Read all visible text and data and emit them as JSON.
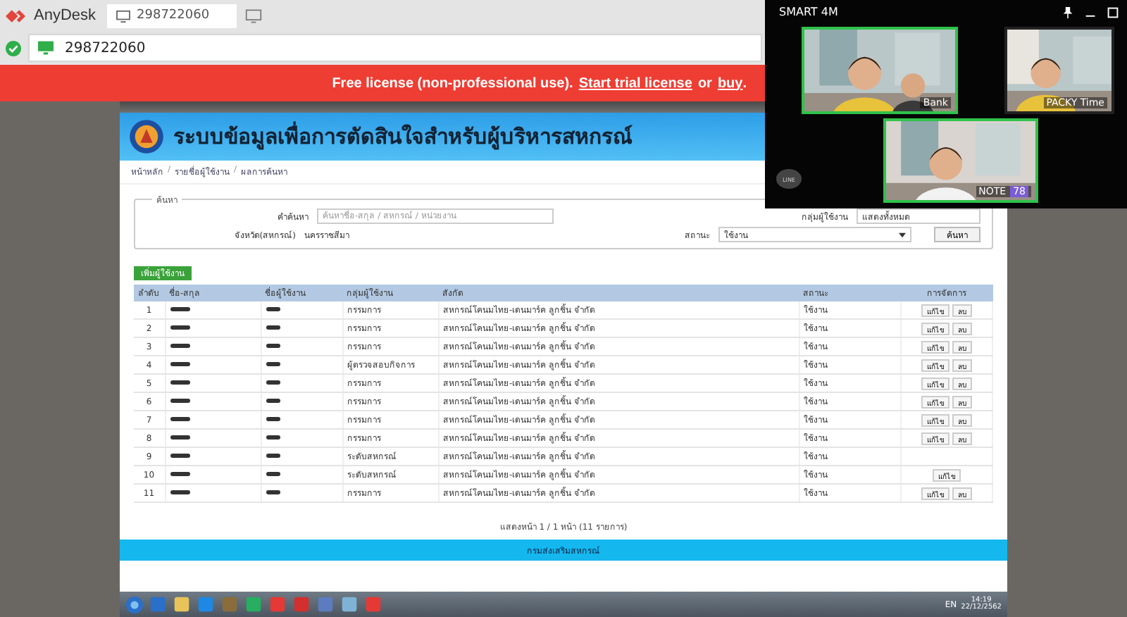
{
  "anydesk": {
    "app_name": "AnyDesk",
    "tab_id": "298722060",
    "address": "298722060",
    "connected": true
  },
  "banner": {
    "text": "Free license (non-professional use).",
    "trial_link": "Start trial license",
    "or": "or",
    "buy_link": "buy",
    "end": "."
  },
  "remote_page": {
    "title": "ระบบข้อมูลเพื่อการตัดสินใจสำหรับผู้บริหารสหกรณ์",
    "breadcrumb": [
      "หน้าหลัก",
      "รายชื่อผู้ใช้งาน",
      "ผลการค้นหา"
    ],
    "breadcrumb_separator": "/",
    "filter": {
      "legend": "ค้นหา",
      "keyword_label": "คำค้นหา",
      "keyword_placeholder": "ค้นหาชื่อ-สกุล / สหกรณ์ / หน่วยงาน",
      "province_label": "จังหวัด(สหกรณ์)",
      "province_value": "นครราชสีมา",
      "group_label": "กลุ่มผู้ใช้งาน",
      "group_value": "แสดงทั้งหมด",
      "status_label": "สถานะ",
      "status_value": "ใช้งาน",
      "search_button": "ค้นหา"
    },
    "add_button": "เพิ่มผู้ใช้งาน",
    "table": {
      "columns": [
        "ลำดับ",
        "ชื่อ-สกุล",
        "ชื่อผู้ใช้งาน",
        "กลุ่มผู้ใช้งาน",
        "สังกัด",
        "สถานะ",
        "การจัดการ"
      ],
      "rows": [
        {
          "no": "1",
          "group": "กรรมการ",
          "affiliation": "สหกรณ์โคนมไทย-เดนมาร์ค ลูกชิ้น จำกัด",
          "status": "ใช้งาน",
          "actions": [
            "แก้ไข",
            "ลบ"
          ]
        },
        {
          "no": "2",
          "group": "กรรมการ",
          "affiliation": "สหกรณ์โคนมไทย-เดนมาร์ค ลูกชิ้น จำกัด",
          "status": "ใช้งาน",
          "actions": [
            "แก้ไข",
            "ลบ"
          ]
        },
        {
          "no": "3",
          "group": "กรรมการ",
          "affiliation": "สหกรณ์โคนมไทย-เดนมาร์ค ลูกชิ้น จำกัด",
          "status": "ใช้งาน",
          "actions": [
            "แก้ไข",
            "ลบ"
          ]
        },
        {
          "no": "4",
          "group": "ผู้ตรวจสอบกิจการ",
          "affiliation": "สหกรณ์โคนมไทย-เดนมาร์ค ลูกชิ้น จำกัด",
          "status": "ใช้งาน",
          "actions": [
            "แก้ไข",
            "ลบ"
          ]
        },
        {
          "no": "5",
          "group": "กรรมการ",
          "affiliation": "สหกรณ์โคนมไทย-เดนมาร์ค ลูกชิ้น จำกัด",
          "status": "ใช้งาน",
          "actions": [
            "แก้ไข",
            "ลบ"
          ]
        },
        {
          "no": "6",
          "group": "กรรมการ",
          "affiliation": "สหกรณ์โคนมไทย-เดนมาร์ค ลูกชิ้น จำกัด",
          "status": "ใช้งาน",
          "actions": [
            "แก้ไข",
            "ลบ"
          ]
        },
        {
          "no": "7",
          "group": "กรรมการ",
          "affiliation": "สหกรณ์โคนมไทย-เดนมาร์ค ลูกชิ้น จำกัด",
          "status": "ใช้งาน",
          "actions": [
            "แก้ไข",
            "ลบ"
          ]
        },
        {
          "no": "8",
          "group": "กรรมการ",
          "affiliation": "สหกรณ์โคนมไทย-เดนมาร์ค ลูกชิ้น จำกัด",
          "status": "ใช้งาน",
          "actions": [
            "แก้ไข",
            "ลบ"
          ]
        },
        {
          "no": "9",
          "group": "ระดับสหกรณ์",
          "affiliation": "สหกรณ์โคนมไทย-เดนมาร์ค ลูกชิ้น จำกัด",
          "status": "ใช้งาน",
          "actions": []
        },
        {
          "no": "10",
          "group": "ระดับสหกรณ์",
          "affiliation": "สหกรณ์โคนมไทย-เดนมาร์ค ลูกชิ้น จำกัด",
          "status": "ใช้งาน",
          "actions": [
            "แก้ไข"
          ]
        },
        {
          "no": "11",
          "group": "กรรมการ",
          "affiliation": "สหกรณ์โคนมไทย-เดนมาร์ค ลูกชิ้น จำกัด",
          "status": "ใช้งาน",
          "actions": [
            "แก้ไข",
            "ลบ"
          ]
        }
      ]
    },
    "pagination": "แสดงหน้า 1 / 1 หน้า (11 รายการ)",
    "footer": "กรมส่งเสริมสหกรณ์"
  },
  "taskbar": {
    "clock": "14:19",
    "date": "22/12/2562",
    "language": "EN"
  },
  "video_call": {
    "title": "SMART 4M",
    "line_badge": "LINE",
    "participants": [
      {
        "name": "Bank",
        "highlighted": true
      },
      {
        "name": "PACKY Time",
        "highlighted": false
      },
      {
        "name": "NOTE",
        "highlighted": true,
        "badge": "78"
      }
    ]
  }
}
